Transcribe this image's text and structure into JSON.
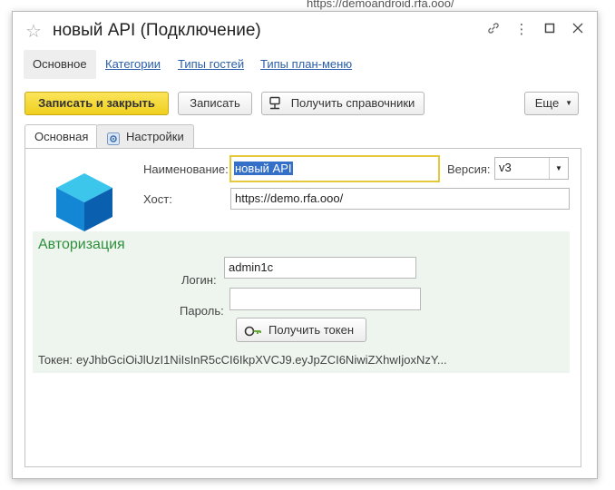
{
  "background_url": "https://demoandroid.rfa.ooo/",
  "window": {
    "title": "новый API (Подключение)",
    "icons": [
      "star-icon",
      "link-icon",
      "more-icon",
      "maximize-icon",
      "close-icon"
    ]
  },
  "nav": {
    "items": [
      {
        "label": "Основное",
        "active": true
      },
      {
        "label": "Категории",
        "active": false
      },
      {
        "label": "Типы гостей",
        "active": false
      },
      {
        "label": "Типы план-меню",
        "active": false
      }
    ]
  },
  "toolbar": {
    "save_close_label": "Записать и закрыть",
    "save_label": "Записать",
    "get_refs_label": "Получить справочники",
    "more_label": "Еще"
  },
  "tabs": [
    {
      "label": "Основная",
      "active": true
    },
    {
      "label": "Настройки",
      "active": false
    }
  ],
  "form": {
    "name_label": "Наименование:",
    "name_value": "новый API",
    "version_label": "Версия:",
    "version_value": "v3",
    "host_label": "Хост:",
    "host_value": "https://demo.rfa.ooo/"
  },
  "auth": {
    "title": "Авторизация",
    "login_label": "Логин:",
    "login_value": "admin1c",
    "password_label": "Пароль:",
    "password_value": "",
    "get_token_label": "Получить токен",
    "token_label": "Токен:",
    "token_value": "eyJhbGciOiJlUzI1NiIsInR5cCI6IkpXVCJ9.eyJpZCI6NiwiZXhwIjoxNzY..."
  },
  "colors": {
    "primary_button": "#f4d935",
    "auth_background": "#eef5ee",
    "auth_title": "#2d8f3c",
    "link": "#2a5ea8"
  }
}
